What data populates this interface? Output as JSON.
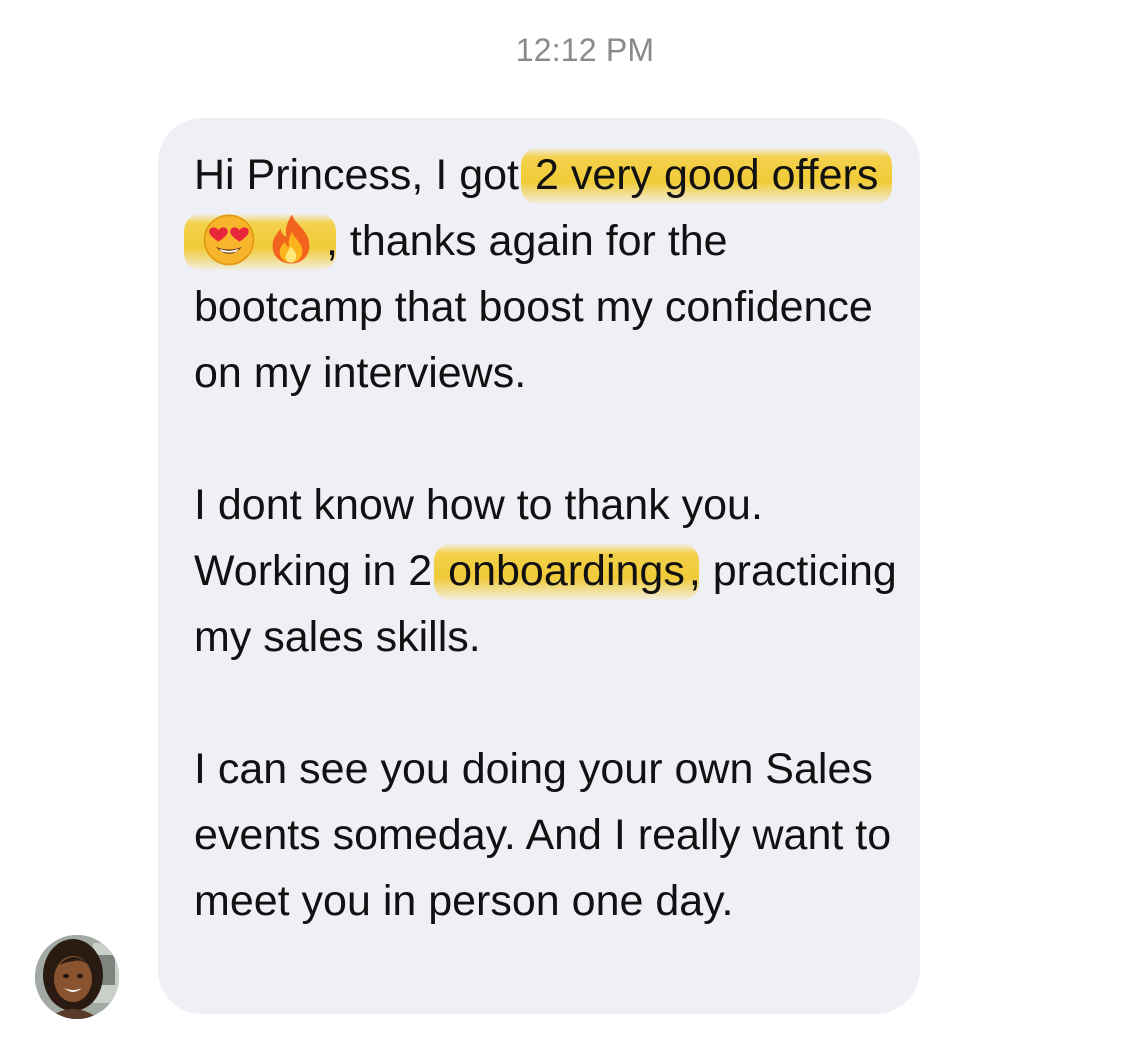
{
  "timestamp": "12:12 PM",
  "message": {
    "p1": {
      "t1": "Hi Princess, I got ",
      "h1": "2 very good offers",
      "e1": "heart-eyes-emoji",
      "e2": "fire-emoji",
      "t2": ", thanks again for the bootcamp that boost my confidence on my interviews."
    },
    "p2": {
      "t1": "I dont know how to thank you. Working in 2 ",
      "h1": "onboardings",
      "t2": ", practicing my sales skills."
    },
    "p3": {
      "text": "I can see you doing your own Sales events someday. And I really want to meet you in person one day."
    }
  },
  "highlight_color": "#F5C81C",
  "bubble_color": "#EFF0F6",
  "timestamp_color": "#8A8A8E"
}
